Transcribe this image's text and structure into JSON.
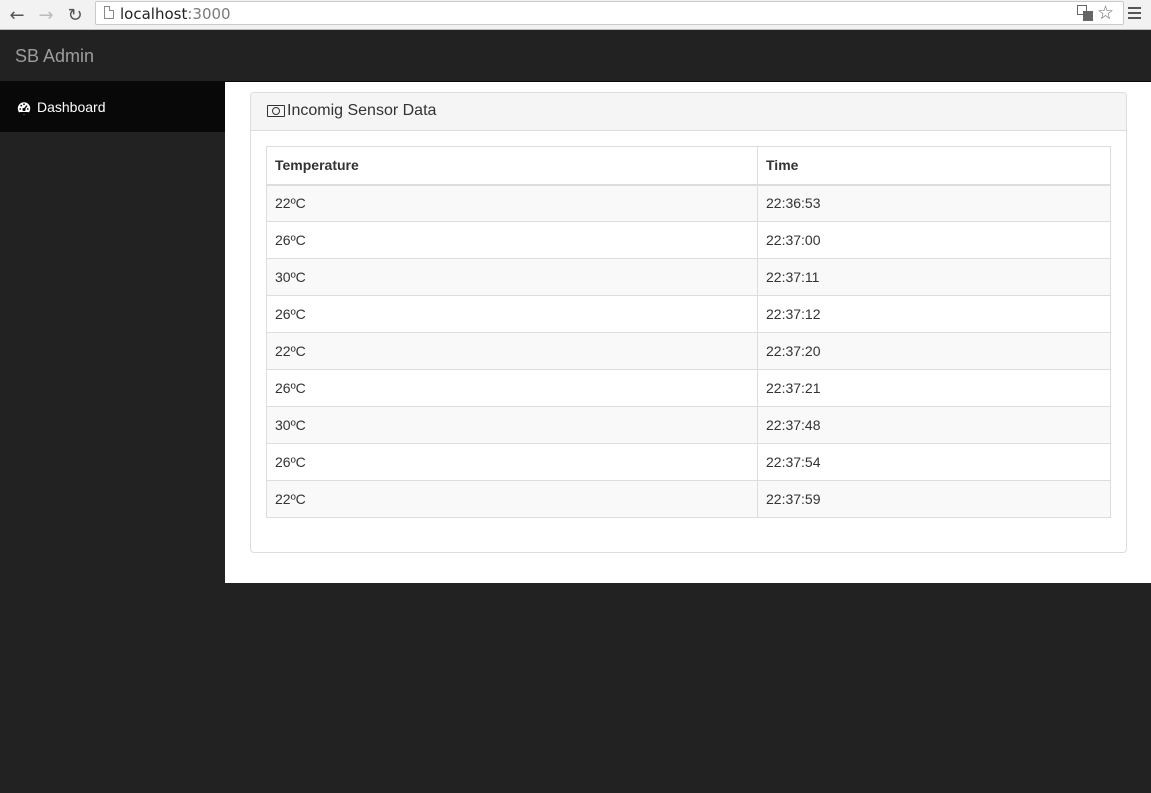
{
  "browser": {
    "url_host": "localhost",
    "url_port": ":3000"
  },
  "navbar": {
    "brand": "SB Admin"
  },
  "sidebar": {
    "items": [
      {
        "label": "Dashboard",
        "icon": "dashboard-icon"
      }
    ]
  },
  "panel": {
    "title": "Incomig Sensor Data",
    "icon": "money-icon"
  },
  "table": {
    "headers": [
      "Temperature",
      "Time"
    ],
    "rows": [
      [
        "22ºC",
        "22:36:53"
      ],
      [
        "26ºC",
        "22:37:00"
      ],
      [
        "30ºC",
        "22:37:11"
      ],
      [
        "26ºC",
        "22:37:12"
      ],
      [
        "22ºC",
        "22:37:20"
      ],
      [
        "26ºC",
        "22:37:21"
      ],
      [
        "30ºC",
        "22:37:48"
      ],
      [
        "26ºC",
        "22:37:54"
      ],
      [
        "22ºC",
        "22:37:59"
      ]
    ]
  },
  "colors": {
    "navbar_bg": "#222222",
    "sidebar_active_bg": "#080808",
    "brand_text": "#9d9d9d",
    "panel_heading_bg": "#f5f5f5",
    "stripe_bg": "#f9f9f9"
  }
}
